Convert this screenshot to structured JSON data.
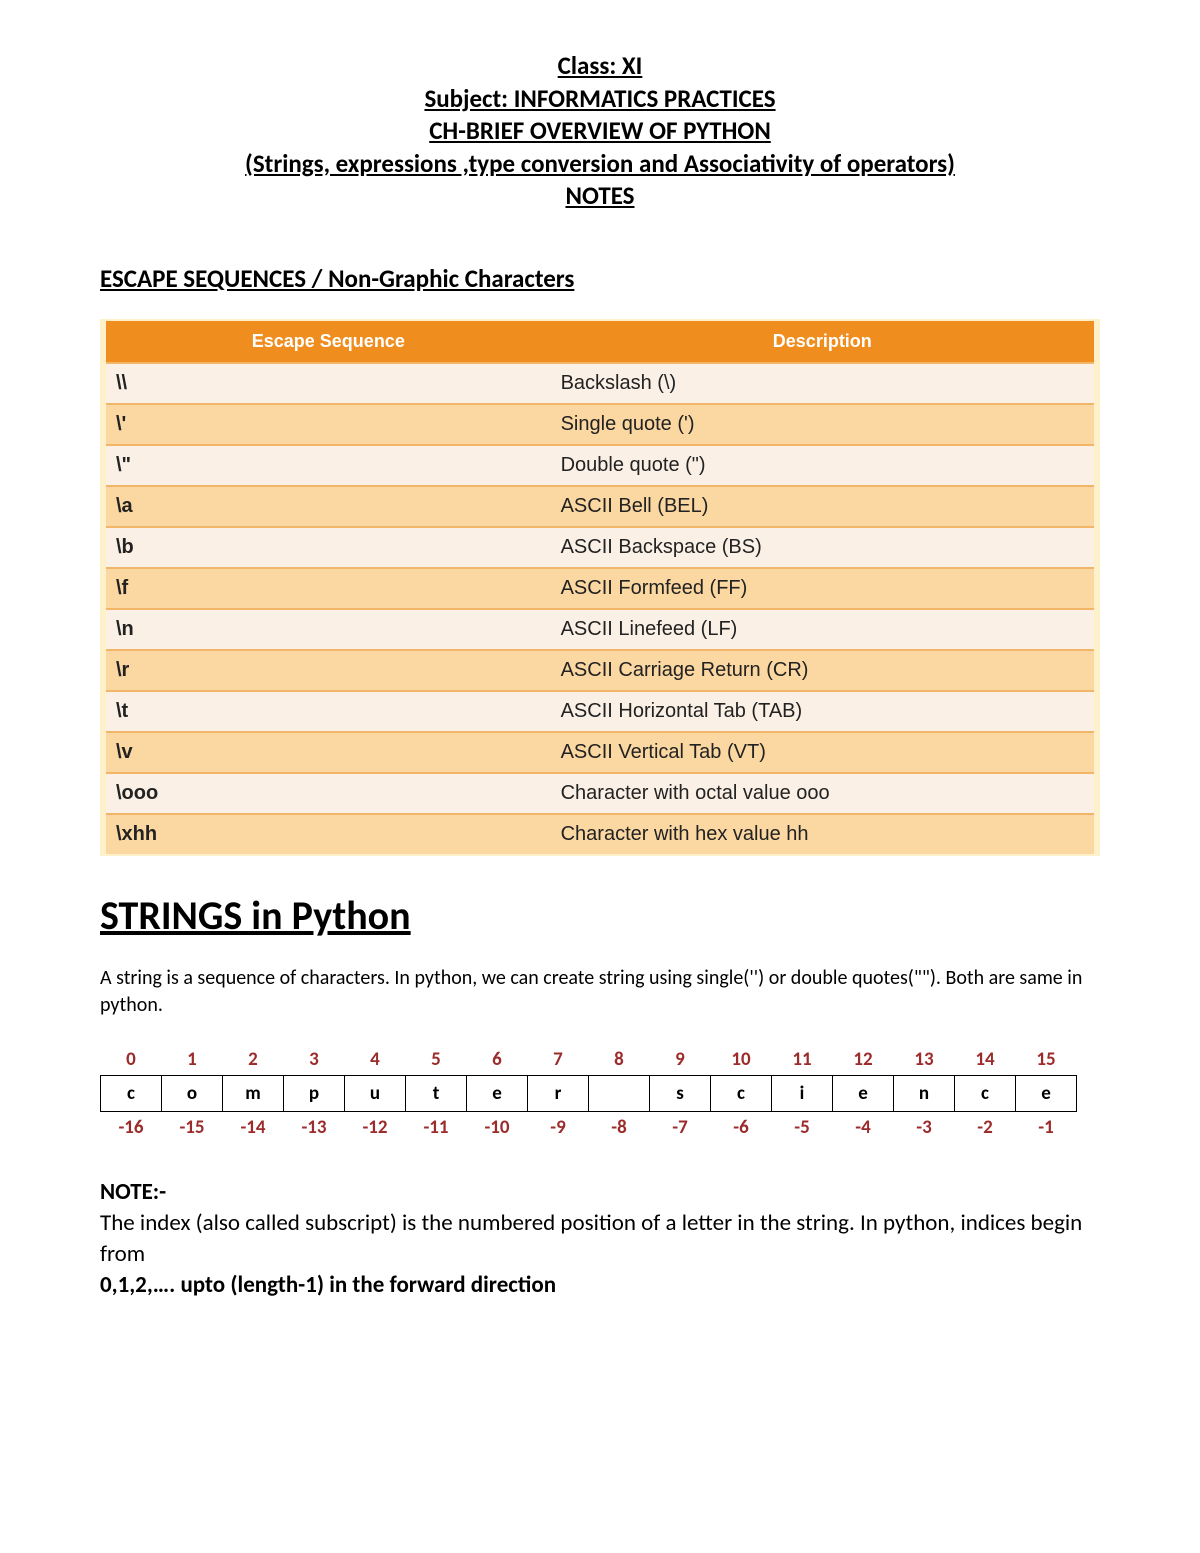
{
  "header": {
    "line1": "Class: XI",
    "line2": "Subject: INFORMATICS PRACTICES",
    "line3": "CH-BRIEF OVERVIEW OF PYTHON",
    "line4": "(Strings, expressions ,type conversion and Associativity of operators)",
    "line5": "NOTES"
  },
  "section1_title": "ESCAPE SEQUENCES / Non-Graphic Characters",
  "esc_table": {
    "head_seq": "Escape Sequence",
    "head_desc": "Description",
    "rows": [
      {
        "seq": "\\\\",
        "desc": "Backslash (\\)"
      },
      {
        "seq": "\\'",
        "desc": "Single quote (')"
      },
      {
        "seq": "\\\"",
        "desc": "Double quote (\")"
      },
      {
        "seq": "\\a",
        "desc": "ASCII Bell (BEL)"
      },
      {
        "seq": "\\b",
        "desc": "ASCII Backspace (BS)"
      },
      {
        "seq": "\\f",
        "desc": "ASCII Formfeed (FF)"
      },
      {
        "seq": "\\n",
        "desc": "ASCII Linefeed (LF)"
      },
      {
        "seq": "\\r",
        "desc": "ASCII Carriage Return (CR)"
      },
      {
        "seq": "\\t",
        "desc": "ASCII Horizontal Tab (TAB)"
      },
      {
        "seq": "\\v",
        "desc": "ASCII Vertical Tab (VT)"
      },
      {
        "seq": "\\ooo",
        "desc": "Character with octal value ooo"
      },
      {
        "seq": "\\xhh",
        "desc": "Character with hex value hh"
      }
    ]
  },
  "strings_heading": "STRINGS in Python",
  "strings_para": "A string is a sequence of characters. In python, we can create string using single('') or double quotes(\"\"). Both are same in python.",
  "index_diagram": {
    "positive": [
      "0",
      "1",
      "2",
      "3",
      "4",
      "5",
      "6",
      "7",
      "8",
      "9",
      "10",
      "11",
      "12",
      "13",
      "14",
      "15"
    ],
    "chars": [
      "c",
      "o",
      "m",
      "p",
      "u",
      "t",
      "e",
      "r",
      " ",
      "s",
      "c",
      "i",
      "e",
      "n",
      "c",
      "e"
    ],
    "negative": [
      "-16",
      "-15",
      "-14",
      "-13",
      "-12",
      "-11",
      "-10",
      "-9",
      "-8",
      "-7",
      "-6",
      "-5",
      "-4",
      "-3",
      "-2",
      "-1"
    ]
  },
  "note": {
    "title": "NOTE:-",
    "body": "The index (also called subscript) is the numbered position of a letter in the string. In python, indices begin from",
    "bold_line": "0,1,2,…. upto (length-1) in the forward direction"
  }
}
